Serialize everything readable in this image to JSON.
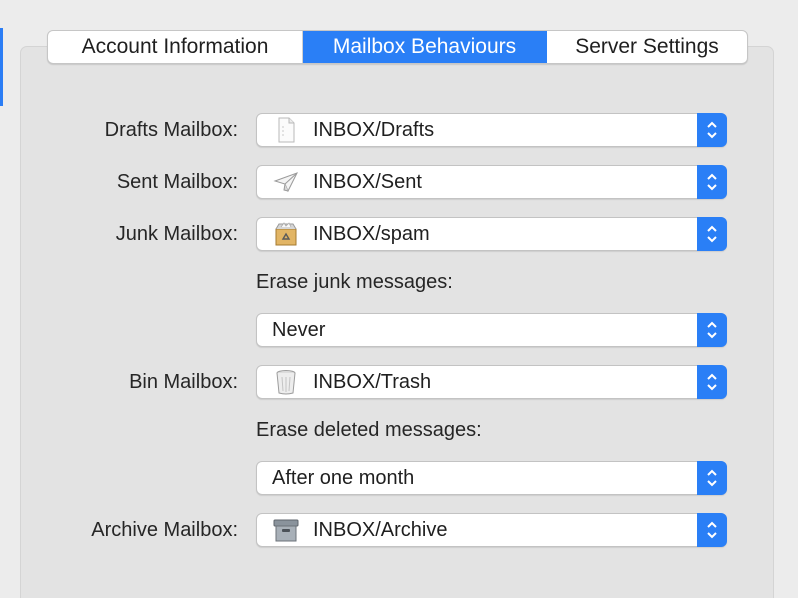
{
  "tabs": [
    {
      "label": "Account Information",
      "active": false
    },
    {
      "label": "Mailbox Behaviours",
      "active": true
    },
    {
      "label": "Server Settings",
      "active": false
    }
  ],
  "drafts": {
    "label": "Drafts Mailbox:",
    "value": "INBOX/Drafts",
    "icon": "drafts-document-icon"
  },
  "sent": {
    "label": "Sent Mailbox:",
    "value": "INBOX/Sent",
    "icon": "paper-plane-icon"
  },
  "junk": {
    "label": "Junk Mailbox:",
    "value": "INBOX/spam",
    "icon": "junk-box-icon",
    "erase_label": "Erase junk messages:",
    "erase_value": "Never"
  },
  "bin": {
    "label": "Bin Mailbox:",
    "value": "INBOX/Trash",
    "icon": "trash-can-icon",
    "erase_label": "Erase deleted messages:",
    "erase_value": "After one month"
  },
  "archive": {
    "label": "Archive Mailbox:",
    "value": "INBOX/Archive",
    "icon": "archive-box-icon"
  },
  "colors": {
    "accent": "#2a7ff6",
    "background": "#ececec",
    "panel": "#e3e3e3"
  }
}
